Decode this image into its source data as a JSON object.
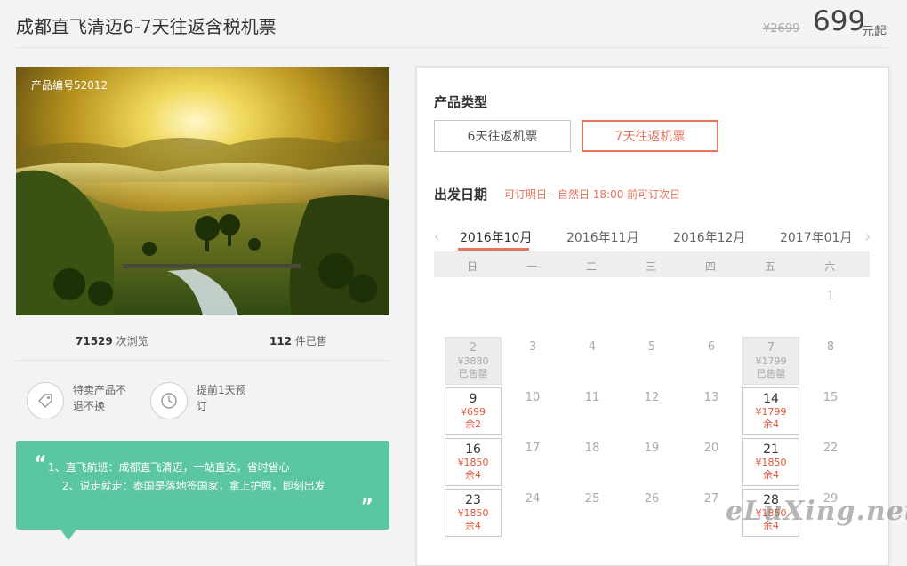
{
  "product": {
    "title": "成都直飞清迈6-7天往返含税机票",
    "original_price": "¥2699",
    "price": "699",
    "price_suffix": "元起"
  },
  "photo": {
    "label": "产品编号52012"
  },
  "stats": {
    "views_count": "71529",
    "views_label": "次浏览",
    "sold_count": "112",
    "sold_label": "件已售"
  },
  "features": [
    {
      "icon": "tag-icon",
      "text": "特卖产品不退不换"
    },
    {
      "icon": "clock-icon",
      "text": "提前1天预订"
    }
  ],
  "quote": {
    "open_mark": "“",
    "close_mark": "”",
    "lines": [
      "1、直飞航班：成都直飞清迈，一站直达，省时省心",
      "2、说走就走：泰国是落地签国家，拿上护照，即刻出发"
    ]
  },
  "booking": {
    "type_label": "产品类型",
    "types": [
      "6天往返机票",
      "7天往返机票"
    ],
    "selected_type": 1,
    "date_label": "出发日期",
    "date_note": "可订明日 - 自然日 18:00 前可订次日",
    "months": [
      "2016年10月",
      "2016年11月",
      "2016年12月",
      "2017年01月"
    ],
    "active_month": 0,
    "weekdays": [
      "日",
      "一",
      "二",
      "三",
      "四",
      "五",
      "六"
    ],
    "weeks": [
      [
        null,
        null,
        null,
        null,
        null,
        null,
        {
          "d": "1"
        }
      ],
      [
        {
          "d": "2",
          "p": "¥3880",
          "s": "已售罄",
          "state": "sold"
        },
        {
          "d": "3"
        },
        {
          "d": "4"
        },
        {
          "d": "5"
        },
        {
          "d": "6"
        },
        {
          "d": "7",
          "p": "¥1799",
          "s": "已售罄",
          "state": "sold"
        },
        {
          "d": "8"
        }
      ],
      [
        {
          "d": "9",
          "p": "¥699",
          "s": "余2",
          "state": "avail"
        },
        {
          "d": "10"
        },
        {
          "d": "11"
        },
        {
          "d": "12"
        },
        {
          "d": "13"
        },
        {
          "d": "14",
          "p": "¥1799",
          "s": "余4",
          "state": "avail"
        },
        {
          "d": "15"
        }
      ],
      [
        {
          "d": "16",
          "p": "¥1850",
          "s": "余4",
          "state": "avail"
        },
        {
          "d": "17"
        },
        {
          "d": "18"
        },
        {
          "d": "19"
        },
        {
          "d": "20"
        },
        {
          "d": "21",
          "p": "¥1850",
          "s": "余4",
          "state": "avail"
        },
        {
          "d": "22"
        }
      ],
      [
        {
          "d": "23",
          "p": "¥1850",
          "s": "余4",
          "state": "avail"
        },
        {
          "d": "24"
        },
        {
          "d": "25"
        },
        {
          "d": "26"
        },
        {
          "d": "27"
        },
        {
          "d": "28",
          "p": "¥1850",
          "s": "余4",
          "state": "avail"
        },
        {
          "d": "29"
        }
      ]
    ]
  },
  "watermark": "eLuXing.net",
  "colors": {
    "accent": "#e6735e",
    "price_red": "#e2553a",
    "quote_bg": "#5bc6a3"
  }
}
